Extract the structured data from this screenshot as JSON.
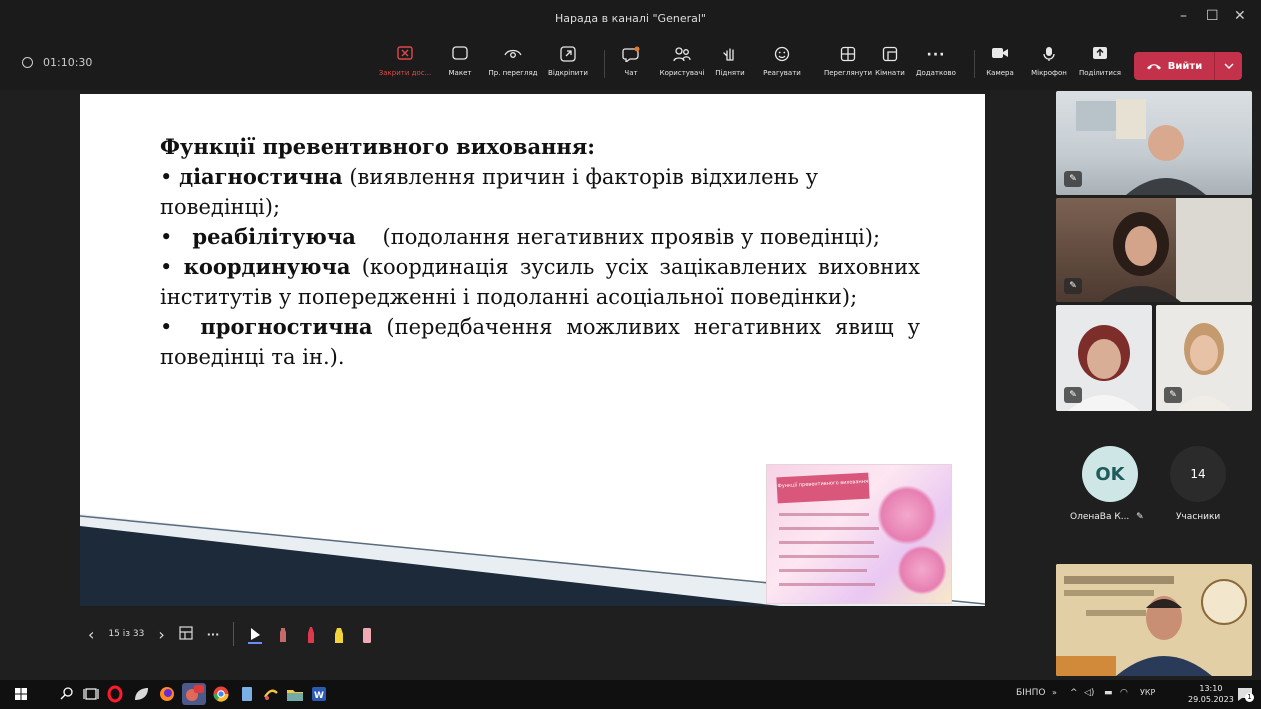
{
  "window": {
    "title": "Нарада в каналі \"General\"",
    "controls": [
      "–",
      "☐",
      "✕"
    ]
  },
  "meeting": {
    "timer": "01:10:30"
  },
  "toolbar": {
    "items": [
      {
        "label": "Закрити дос...",
        "icon": "close-share-icon"
      },
      {
        "label": "Макет",
        "icon": "layout-icon"
      },
      {
        "label": "Пр. перегляд",
        "icon": "eye-icon"
      },
      {
        "label": "Відкріпити",
        "icon": "popout-icon"
      },
      {
        "label": "Чат",
        "icon": "chat-icon"
      },
      {
        "label": "Користувачі",
        "icon": "people-icon"
      },
      {
        "label": "Підняти",
        "icon": "raise-hand-icon"
      },
      {
        "label": "Реагувати",
        "icon": "smiley-icon"
      },
      {
        "label": "Переглянути",
        "icon": "grid-icon"
      },
      {
        "label": "Кімнати",
        "icon": "rooms-icon"
      },
      {
        "label": "Додатково",
        "icon": "more-icon"
      },
      {
        "label": "Камера",
        "icon": "camera-icon"
      },
      {
        "label": "Мікрофон",
        "icon": "mic-icon"
      },
      {
        "label": "Поділитися",
        "icon": "share-icon"
      }
    ],
    "leave_label": "Вийти",
    "accent": "#c4314b"
  },
  "slide": {
    "heading": "Функції превентивного виховання:",
    "items": [
      {
        "term": "діагностична",
        "desc": "(виявлення причин і факторів відхилень у поведінці);"
      },
      {
        "term": "реабілітуюча",
        "desc": "(подолання негативних проявів у поведінці);"
      },
      {
        "term": "координуюча",
        "desc": "(координація зусиль усіх зацікавлених виховних інститутів у попередженні і подоланні асоціальної поведінки);"
      },
      {
        "term": "прогностична",
        "desc": "(передбачення можливих негативних явищ у поведінці та ін.)."
      }
    ],
    "bullet": "•",
    "thumbnail_title": "Функції превентивного виховання"
  },
  "slide_controls": {
    "page": "15 із 33",
    "prev": "‹",
    "next": "›",
    "more": "···"
  },
  "participants": {
    "avatar_initials": "OK",
    "avatar_name": "ОленаВа К...",
    "count": "14",
    "count_label": "Учасники"
  },
  "taskbar": {
    "lang_tag": "БІНПО",
    "lang": "УКР",
    "time": "13:10",
    "date": "29.05.2023",
    "notif": "1"
  }
}
